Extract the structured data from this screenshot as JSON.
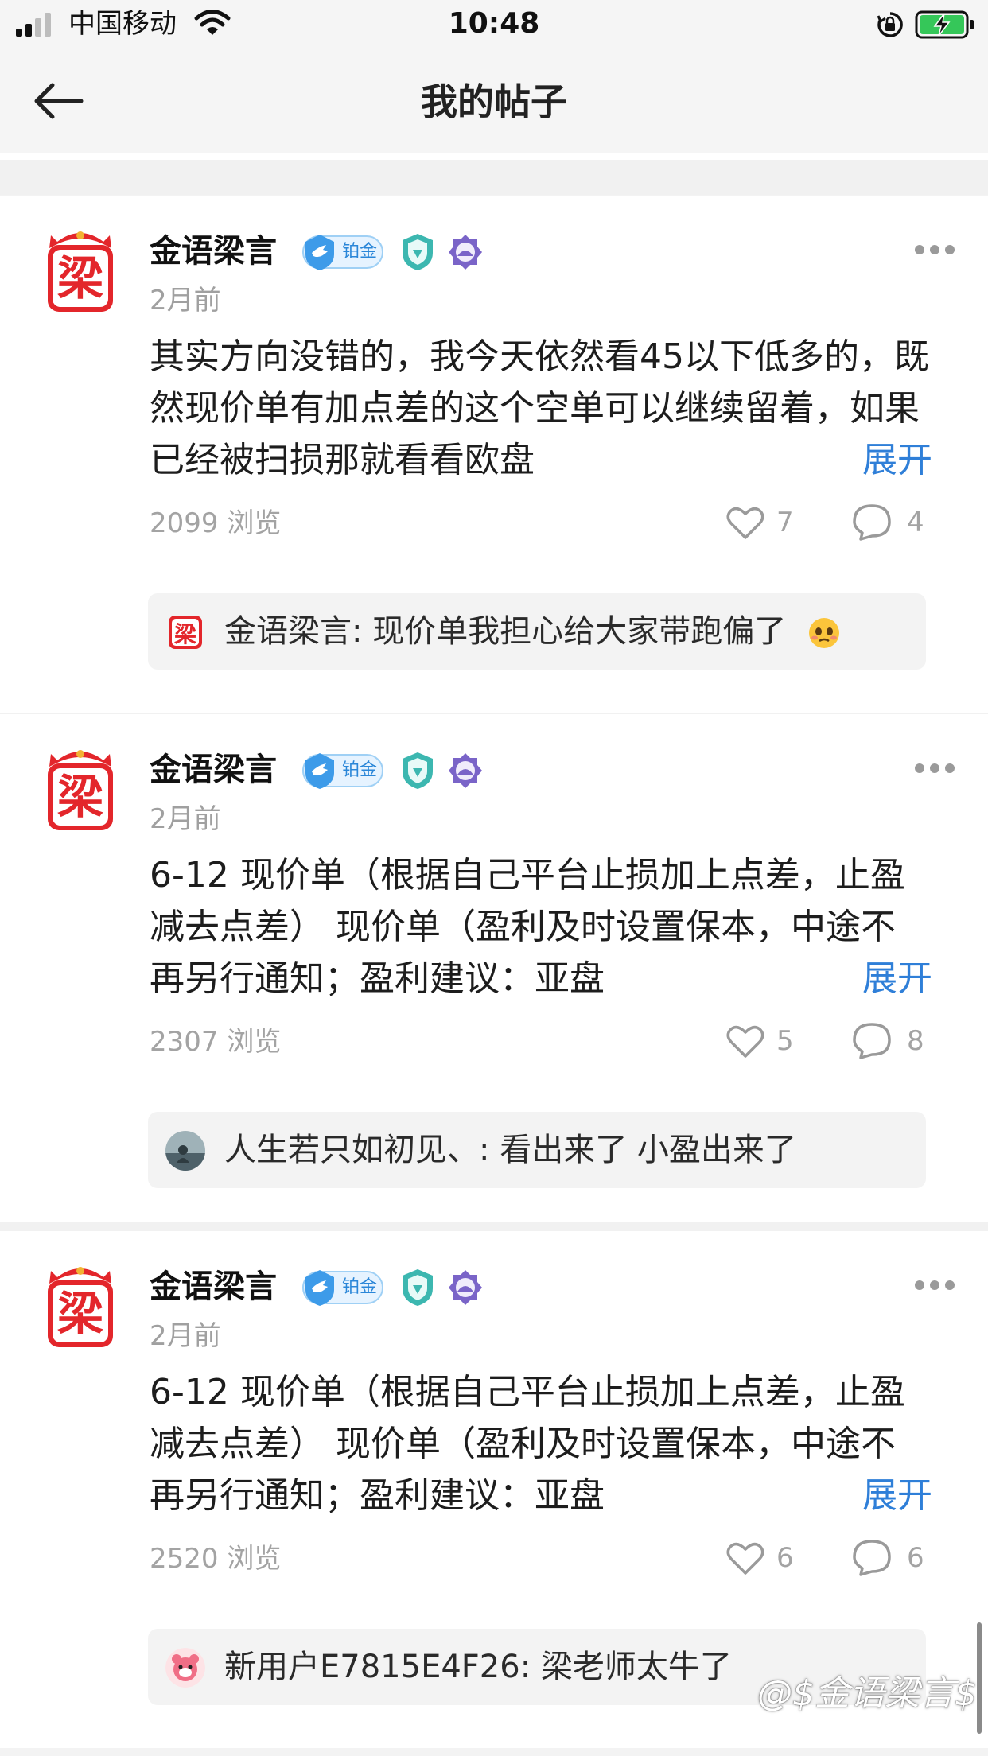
{
  "status_bar": {
    "carrier": "中国移动",
    "time": "10:48"
  },
  "nav": {
    "title": "我的帖子",
    "back_icon": "arrow-left-icon"
  },
  "posts": [
    {
      "author": "金语梁言",
      "badge_label": "铂金",
      "time": "2月前",
      "content": "其实方向没错的，我今天依然看45以下低多的，既然现价单有加点差的这个空单可以继续留着，如果已经被扫损那就看看欧盘",
      "expand_label": "展开",
      "views": "2099 浏览",
      "likes": "7",
      "comments": "4",
      "comment_preview": {
        "user": "金语梁言",
        "separator": ": ",
        "text": "现价单我担心给大家带跑偏了",
        "has_emoji": true
      }
    },
    {
      "author": "金语梁言",
      "badge_label": "铂金",
      "time": "2月前",
      "content": "6-12 现价单（根据自己平台止损加上点差，止盈减去点差） 现价单（盈利及时设置保本，中途不再另行通知；盈利建议：亚盘",
      "expand_label": "展开",
      "views": "2307 浏览",
      "likes": "5",
      "comments": "8",
      "comment_preview": {
        "user": "人生若只如初见、",
        "separator": ": ",
        "text": "看出来了 小盈出来了",
        "has_emoji": false
      }
    },
    {
      "author": "金语梁言",
      "badge_label": "铂金",
      "time": "2月前",
      "content": "6-12 现价单（根据自己平台止损加上点差，止盈减去点差） 现价单（盈利及时设置保本，中途不再另行通知；盈利建议：亚盘",
      "expand_label": "展开",
      "views": "2520 浏览",
      "likes": "6",
      "comments": "6",
      "comment_preview": {
        "user": "新用户E7815E4F26",
        "separator": ": ",
        "text": "梁老师太牛了",
        "has_emoji": false
      }
    }
  ],
  "watermark": "@$金语梁言$",
  "colors": {
    "link_blue": "#2f7fd8",
    "avatar_red": "#e3262b",
    "badge_blue": "#2a86d8",
    "shield_teal": "#3cb7b0",
    "lotus_purple": "#7a64c8"
  }
}
